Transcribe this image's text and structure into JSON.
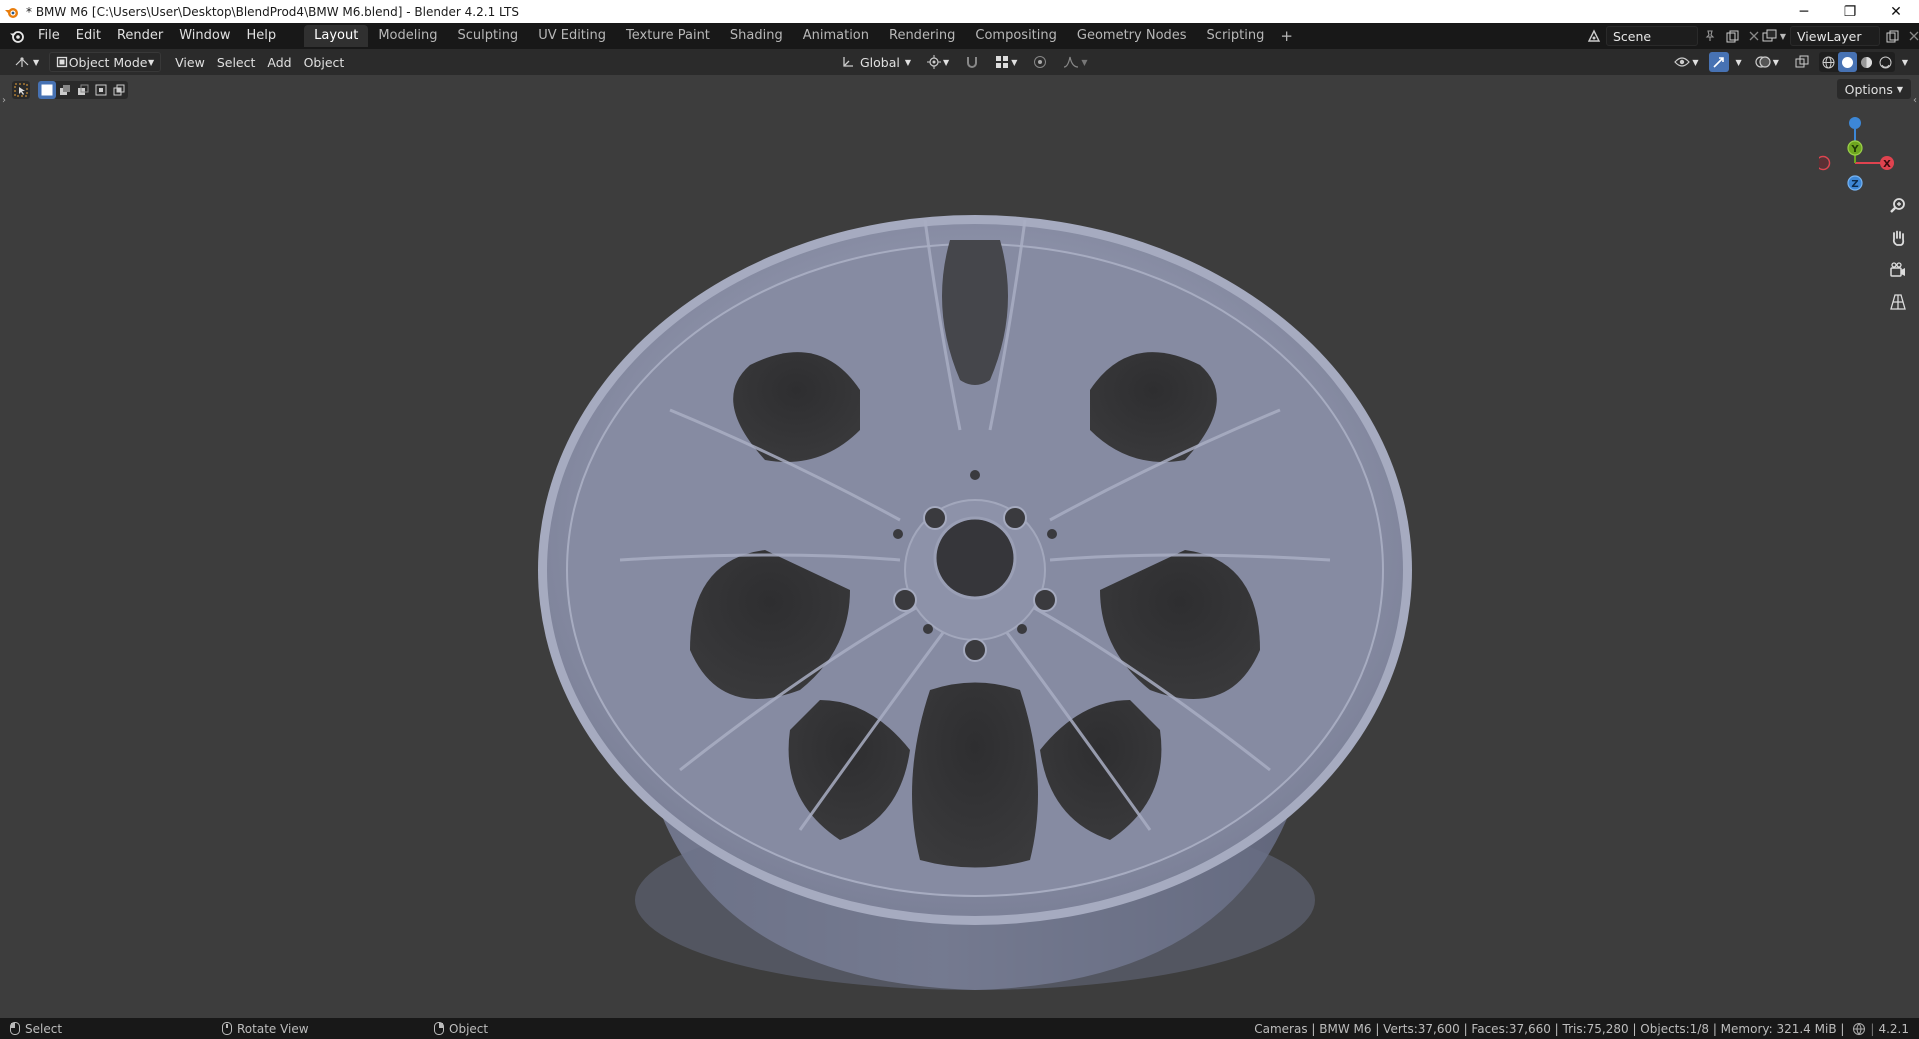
{
  "window": {
    "title": "* BMW M6 [C:\\Users\\User\\Desktop\\BlendProd4\\BMW M6.blend] - Blender 4.2.1 LTS",
    "controls": {
      "minimize": "─",
      "restore": "❐",
      "close": "✕"
    }
  },
  "menu": {
    "items": [
      "File",
      "Edit",
      "Render",
      "Window",
      "Help"
    ]
  },
  "workspaces": {
    "tabs": [
      "Layout",
      "Modeling",
      "Sculpting",
      "UV Editing",
      "Texture Paint",
      "Shading",
      "Animation",
      "Rendering",
      "Compositing",
      "Geometry Nodes",
      "Scripting"
    ],
    "active": "Layout",
    "add": "+"
  },
  "scene": {
    "name": "Scene"
  },
  "view_layer": {
    "name": "ViewLayer"
  },
  "viewport_header": {
    "mode": "Object Mode",
    "menus": [
      "View",
      "Select",
      "Add",
      "Object"
    ],
    "transform_orientation": "Global"
  },
  "viewport": {
    "options_label": "Options",
    "gizmo_axes": {
      "x": "X",
      "y": "Y",
      "z": "Z"
    }
  },
  "statusbar": {
    "hints": [
      {
        "icon": "mouse-left-icon",
        "label": "Select"
      },
      {
        "icon": "mouse-middle-icon",
        "label": "Rotate View"
      },
      {
        "icon": "mouse-right-icon",
        "label": "Object"
      }
    ],
    "stats": "Cameras | BMW M6 | Verts:37,600 | Faces:37,660 | Tris:75,280 | Objects:1/8 | Memory: 321.4 MiB |",
    "version": "4.2.1"
  },
  "colors": {
    "accent": "#4772b3",
    "viewport_bg": "#3d3d3d",
    "wheel": "#8e93ab",
    "axis_x": "#e0434f",
    "axis_y": "#6ea51f",
    "axis_z": "#3d87d6"
  }
}
